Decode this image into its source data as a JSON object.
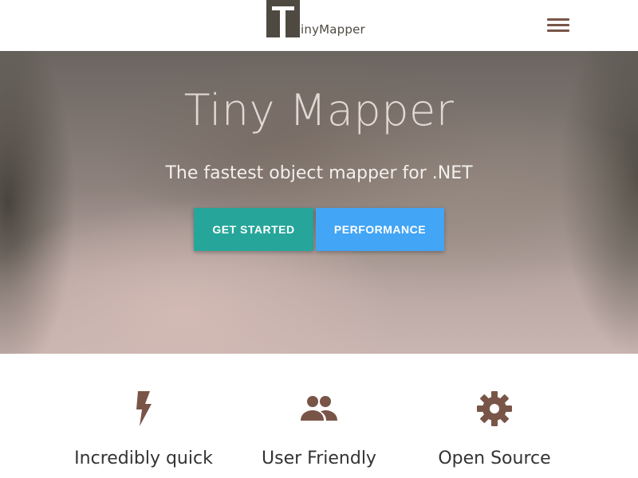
{
  "header": {
    "logo_text": "inyMapper",
    "menu_icon": "hamburger-menu-icon"
  },
  "hero": {
    "title": "Tiny Mapper",
    "subtitle": "The fastest object mapper for .NET",
    "buttons": [
      {
        "label": "GET STARTED",
        "color": "#26a69a"
      },
      {
        "label": "PERFORMANCE",
        "color": "#42a5f5"
      }
    ]
  },
  "features": [
    {
      "icon": "bolt-icon",
      "label": "Incredibly quick"
    },
    {
      "icon": "people-icon",
      "label": "User Friendly"
    },
    {
      "icon": "gear-icon",
      "label": "Open Source"
    }
  ],
  "colors": {
    "accent_brown": "#795548",
    "logo_dark": "#4e4a42",
    "teal": "#26a69a",
    "blue": "#42a5f5"
  }
}
